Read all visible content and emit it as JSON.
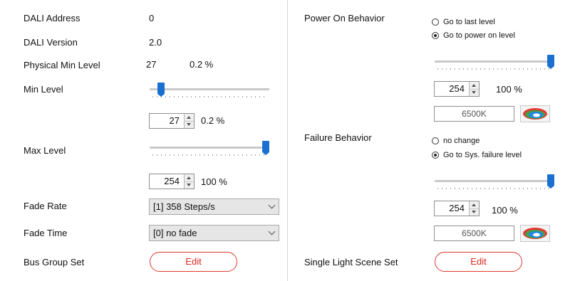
{
  "left": {
    "dali_address_label": "DALI Address",
    "dali_address_value": "0",
    "dali_version_label": "DALI Version",
    "dali_version_value": "2.0",
    "phys_min_label": "Physical Min Level",
    "phys_min_value": "27",
    "phys_min_percent": "0.2 %",
    "min_level_label": "Min Level",
    "min_level_value": "27",
    "min_level_percent": "0.2 %",
    "min_level_slider_fraction": 0.07,
    "max_level_label": "Max Level",
    "max_level_value": "254",
    "max_level_percent": "100 %",
    "max_level_slider_fraction": 1.0,
    "fade_rate_label": "Fade Rate",
    "fade_rate_selected": "[1] 358 Steps/s",
    "fade_time_label": "Fade Time",
    "fade_time_selected": "[0] no fade",
    "bus_group_label": "Bus Group Set",
    "bus_group_button": "Edit"
  },
  "right": {
    "power_on_label": "Power On Behavior",
    "power_on_options": [
      "Go to last level",
      "Go to power on level"
    ],
    "power_on_selected_index": 1,
    "power_on_slider_fraction": 1.0,
    "power_on_value": "254",
    "power_on_percent": "100 %",
    "power_on_color_temp": "6500K",
    "failure_label": "Failure Behavior",
    "failure_options": [
      "no change",
      "Go to Sys. failure level"
    ],
    "failure_selected_index": 1,
    "failure_slider_fraction": 1.0,
    "failure_value": "254",
    "failure_percent": "100 %",
    "failure_color_temp": "6500K",
    "scene_label": "Single Light Scene Set",
    "scene_button": "Edit"
  },
  "colors": {
    "accent": "#1a6fd1",
    "edit_border": "#e0392f",
    "edit_text": "#d7281f",
    "dropdown_bg": "#e6e6e6"
  },
  "icons": {
    "palette": "color-palette-icon",
    "spin": "spin-arrows-icon",
    "dropdown": "chevron-down-icon"
  }
}
